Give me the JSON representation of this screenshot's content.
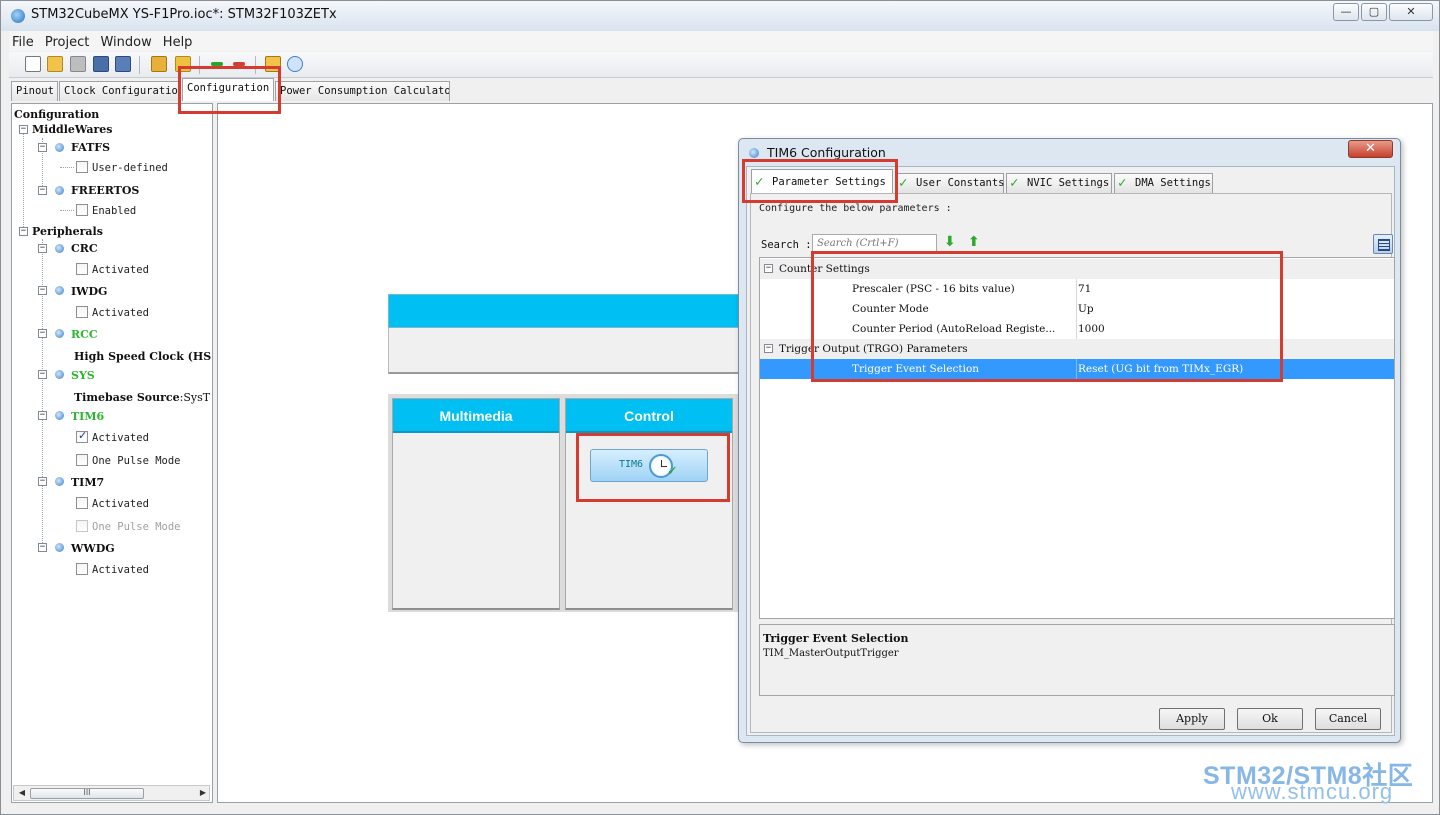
{
  "window": {
    "title": "STM32CubeMX YS-F1Pro.ioc*: STM32F103ZETx",
    "minimize_glyph": "—",
    "maximize_glyph": "▢",
    "close_glyph": "✕"
  },
  "menu": [
    "File",
    "Project",
    "Window",
    "Help"
  ],
  "toolbar_icons": [
    "new-project-icon",
    "open-folder-icon",
    "copy-icon",
    "save-icon",
    "save-as-icon",
    "generate-report-icon",
    "import-icon",
    "zoom-in-icon",
    "zoom-out-icon",
    "help-icon",
    "about-icon"
  ],
  "main_tabs": [
    "Pinout",
    "Clock Configuration",
    "Configuration",
    "Power Consumption Calculator"
  ],
  "active_main_tab": "Configuration",
  "tree": {
    "root": "Configuration",
    "middlewares_label": "MiddleWares",
    "fatfs": {
      "name": "FATFS",
      "option": "User-defined",
      "checked": false
    },
    "freertos": {
      "name": "FREERTOS",
      "option": "Enabled",
      "checked": false
    },
    "peripherals_label": "Peripherals",
    "crc": {
      "name": "CRC",
      "option": "Activated",
      "checked": false
    },
    "iwdg": {
      "name": "IWDG",
      "option": "Activated",
      "checked": false
    },
    "rcc": {
      "name": "RCC",
      "detail": "High Speed Clock (HS"
    },
    "sys": {
      "name": "SYS",
      "detail_label": "Timebase Source",
      "detail_value": ":SysT"
    },
    "tim6": {
      "name": "TIM6",
      "option1": "Activated",
      "option1_checked": true,
      "option2": "One Pulse Mode",
      "option2_checked": false
    },
    "tim7": {
      "name": "TIM7",
      "option1": "Activated",
      "option1_checked": false,
      "option2": "One Pulse Mode",
      "option2_disabled": true
    },
    "wwdg": {
      "name": "WWDG",
      "option": "Activated",
      "checked": false
    },
    "scroll_thumb_glyph": "III",
    "scroll_left": "◀",
    "scroll_right": "▶"
  },
  "workspace": {
    "categories": [
      "Multimedia",
      "Control"
    ],
    "control_items": [
      {
        "label": "TIM6"
      }
    ]
  },
  "dialog": {
    "title": "TIM6 Configuration",
    "close_glyph": "✕",
    "tabs": [
      "Parameter Settings",
      "User Constants",
      "NVIC Settings",
      "DMA Settings"
    ],
    "active_tab": "Parameter Settings",
    "intro": "Configure the below parameters :",
    "search_label": "Search :",
    "search_placeholder": "Search (Crtl+F)",
    "search_down_glyph": "⬇",
    "search_up_glyph": "⬆",
    "groups": [
      {
        "name": "Counter Settings",
        "params": [
          {
            "name": "Prescaler (PSC - 16 bits value)",
            "value": "71"
          },
          {
            "name": "Counter Mode",
            "value": "Up"
          },
          {
            "name": "Counter Period (AutoReload Registe...",
            "value": "1000"
          }
        ]
      },
      {
        "name": "Trigger Output (TRGO) Parameters",
        "params": [
          {
            "name": "Trigger Event Selection",
            "value": "Reset (UG bit from TIMx_EGR)",
            "selected": true
          }
        ]
      }
    ],
    "description_title": "Trigger Event Selection",
    "description_text": "TIM_MasterOutputTrigger",
    "buttons": {
      "apply": "Apply",
      "ok": "Ok",
      "cancel": "Cancel"
    }
  },
  "watermark": {
    "line1": "STM32/STM8社区",
    "line2": "www.stmcu.org"
  },
  "colors": {
    "accent_cyan": "#00bff3",
    "selection_blue": "#3399ff",
    "annotation_red": "#d63b2f",
    "tree_green": "#2db52d"
  }
}
